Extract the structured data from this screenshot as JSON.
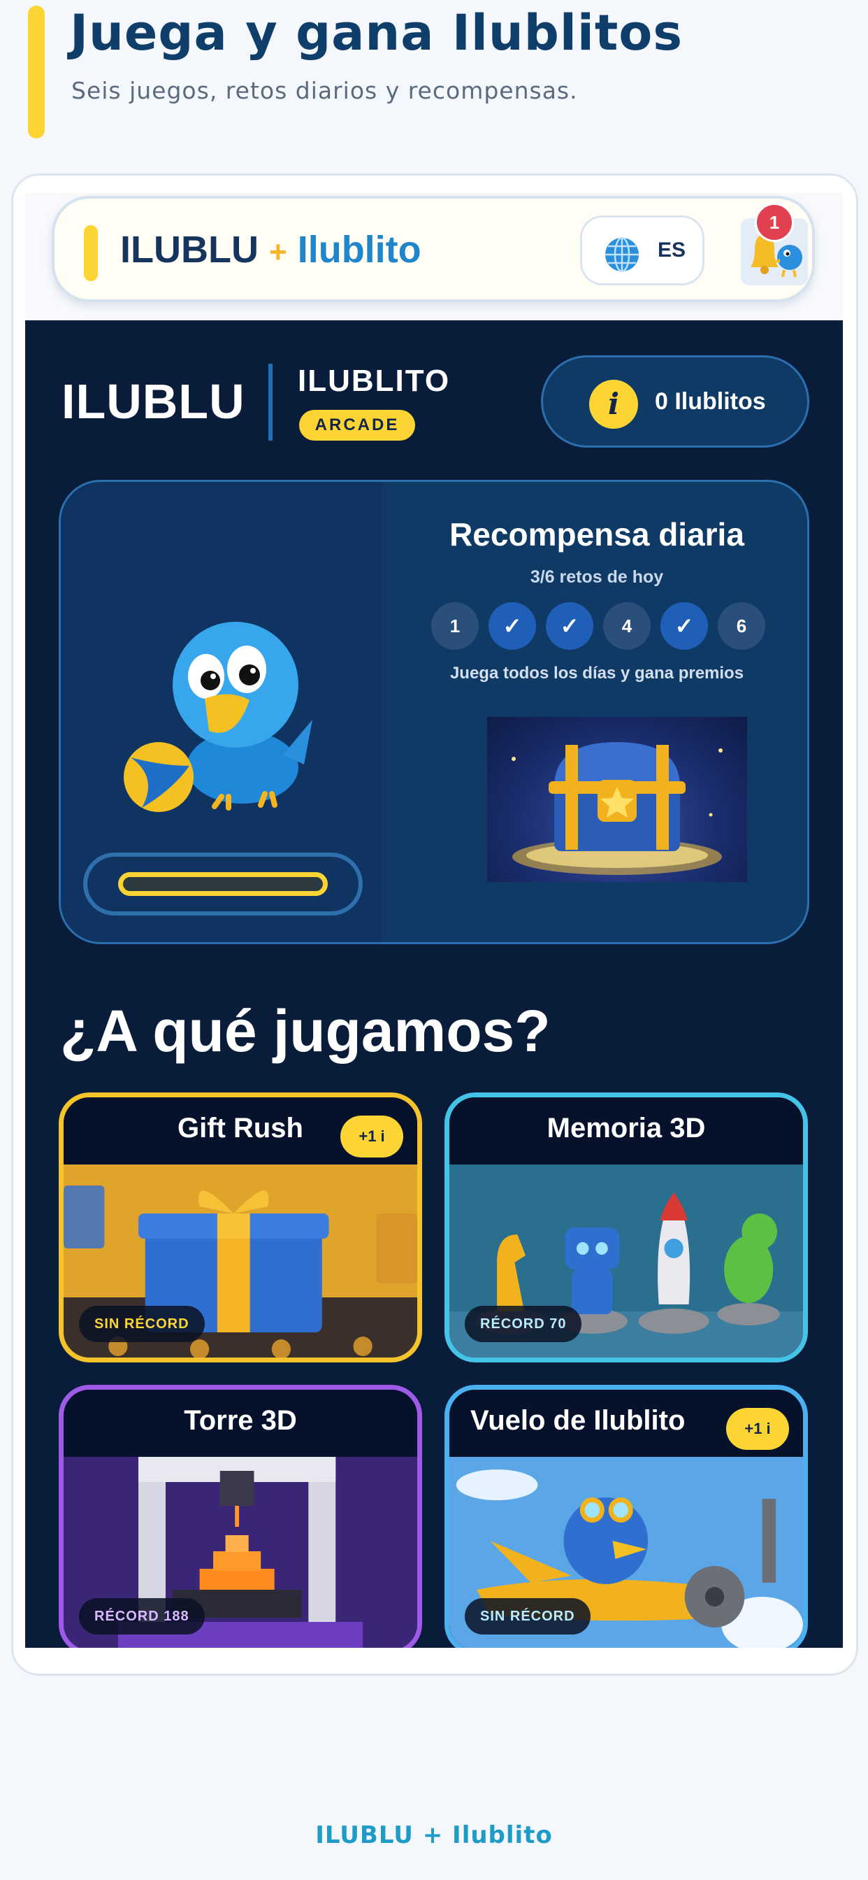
{
  "page": {
    "title": "Juega y gana Ilublitos",
    "subtitle": "Seis juegos, retos diarios y recompensas.",
    "footer": "ILUBLU + Ilublito"
  },
  "topbar": {
    "brand_main": "ILUBLU",
    "brand_plus": "+",
    "brand_second": "Ilublito",
    "language": "ES",
    "language_icon": "globe-icon",
    "notification_icon": "bell-icon",
    "notification_count": "1"
  },
  "arcade": {
    "logo": "ILUBLU",
    "sublogo": "ILUBLITO",
    "tag": "ARCADE",
    "coin_symbol": "i",
    "coins_label": "0 Ilublitos"
  },
  "reward": {
    "title": "Recompensa diaria",
    "count": "3/6 retos de hoy",
    "hint": "Juega todos los días y gana premios",
    "progress_fraction": 0,
    "steps": [
      {
        "label": "1",
        "done": false
      },
      {
        "label": "✓",
        "done": true
      },
      {
        "label": "✓",
        "done": true
      },
      {
        "label": "4",
        "done": false
      },
      {
        "label": "✓",
        "done": true
      },
      {
        "label": "6",
        "done": false
      }
    ]
  },
  "games": {
    "section_title": "¿A qué jugamos?",
    "items": [
      {
        "title": "Gift Rush",
        "badge": "+1 i",
        "record": "SIN RÉCORD",
        "accent": "#f5c32c"
      },
      {
        "title": "Memoria 3D",
        "badge": "",
        "record": "RÉCORD 70",
        "accent": "#43c3e6"
      },
      {
        "title": "Torre 3D",
        "badge": "",
        "record": "RÉCORD 188",
        "accent": "#a05ae8"
      },
      {
        "title": "Vuelo de Ilublito",
        "badge": "+1 i",
        "record": "SIN RÉCORD",
        "accent": "#4ab0f0"
      }
    ]
  },
  "colors": {
    "accent_yellow": "#fcd535",
    "navy": "#091d3b",
    "panel": "#103a66",
    "brand_blue": "#1f86cc"
  }
}
